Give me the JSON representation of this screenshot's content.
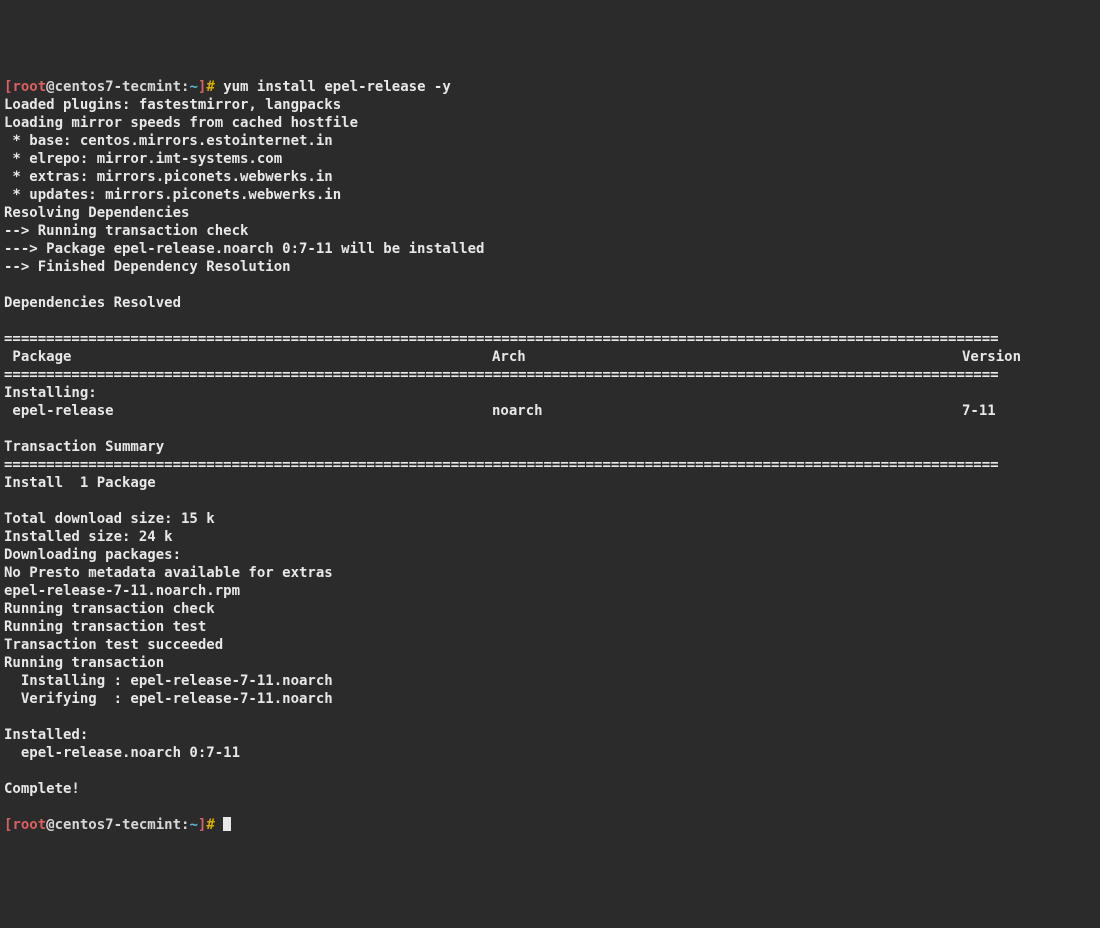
{
  "prompt1": {
    "lbr": "[",
    "user": "root",
    "at": "@",
    "host": "centos7-tecmint",
    "colon": ":",
    "path": "~",
    "rbr": "]",
    "hash": "# ",
    "command": "yum install epel-release -y"
  },
  "lines": [
    "Loaded plugins: fastestmirror, langpacks",
    "Loading mirror speeds from cached hostfile",
    " * base: centos.mirrors.estointernet.in",
    " * elrepo: mirror.imt-systems.com",
    " * extras: mirrors.piconets.webwerks.in",
    " * updates: mirrors.piconets.webwerks.in",
    "Resolving Dependencies",
    "--> Running transaction check",
    "---> Package epel-release.noarch 0:7-11 will be installed",
    "--> Finished Dependency Resolution",
    "",
    "Dependencies Resolved",
    ""
  ],
  "divider": "======================================================================================================================",
  "table_header": {
    "package": " Package",
    "arch": "Arch",
    "version": "Version"
  },
  "install_section_header": "Installing:",
  "install_row": {
    "package": " epel-release",
    "arch": "noarch",
    "version": "7-11"
  },
  "summary_header": "Transaction Summary",
  "summary_line": "Install  1 Package",
  "tail_lines": [
    "Total download size: 15 k",
    "Installed size: 24 k",
    "Downloading packages:",
    "No Presto metadata available for extras",
    "epel-release-7-11.noarch.rpm",
    "Running transaction check",
    "Running transaction test",
    "Transaction test succeeded",
    "Running transaction",
    "  Installing : epel-release-7-11.noarch",
    "  Verifying  : epel-release-7-11.noarch",
    "",
    "Installed:",
    "  epel-release.noarch 0:7-11",
    "",
    "Complete!"
  ],
  "prompt2": {
    "lbr": "[",
    "user": "root",
    "at": "@",
    "host": "centos7-tecmint",
    "colon": ":",
    "path": "~",
    "rbr": "]",
    "hash": "# "
  }
}
